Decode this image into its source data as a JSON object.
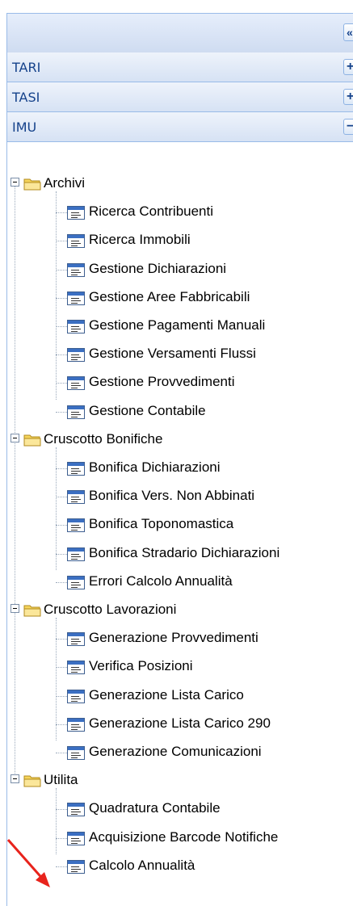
{
  "topbar": {
    "collapse_icon": "double-chevron-left-icon",
    "collapse_glyph": "«"
  },
  "accordion": [
    {
      "label": "TARI",
      "toggle": "+"
    },
    {
      "label": "TASI",
      "toggle": "+"
    },
    {
      "label": "IMU",
      "toggle": "−"
    }
  ],
  "tree": {
    "groups": [
      {
        "label": "Archivi",
        "items": [
          "Ricerca Contribuenti",
          "Ricerca Immobili",
          "Gestione Dichiarazioni",
          "Gestione Aree Fabbricabili",
          "Gestione Pagamenti Manuali",
          "Gestione Versamenti Flussi",
          "Gestione Provvedimenti",
          "Gestione Contabile"
        ]
      },
      {
        "label": "Cruscotto Bonifiche",
        "items": [
          "Bonifica Dichiarazioni",
          "Bonifica Vers. Non Abbinati",
          "Bonifica Toponomastica",
          "Bonifica Stradario Dichiarazioni",
          "Errori Calcolo Annualità"
        ]
      },
      {
        "label": "Cruscotto Lavorazioni",
        "items": [
          "Generazione Provvedimenti",
          "Verifica Posizioni",
          "Generazione Lista Carico",
          "Generazione Lista Carico 290",
          "Generazione Comunicazioni"
        ]
      },
      {
        "label": "Utilita",
        "items": [
          "Quadratura Contabile",
          "Acquisizione Barcode Notifiche",
          "Calcolo Annualità"
        ]
      }
    ]
  },
  "annotation": {
    "arrow_color": "#e8231c"
  },
  "colors": {
    "header_text": "#15428b",
    "border": "#99bbe8",
    "folder": "#f6d55c"
  }
}
